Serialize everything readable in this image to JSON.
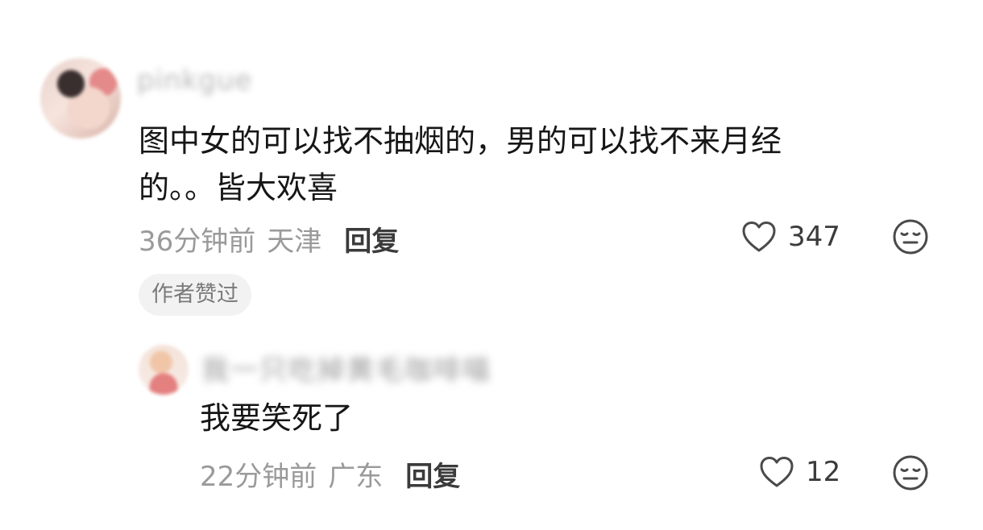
{
  "comment": {
    "username": "pinkgue",
    "text_line1": "图中女的可以找不抽烟的，男的可以找不来月经",
    "text_line2": "的。。皆大欢喜",
    "time": "36分钟前",
    "location": "天津",
    "reply_label": "回复",
    "like_count": "347",
    "badge": "作者赞过",
    "icons": {
      "like": "heart-outline-icon",
      "dislike": "neutral-face-icon"
    }
  },
  "reply": {
    "username": "我一只吃掉黄毛咖啡喵",
    "text": "我要笑死了",
    "time": "22分钟前",
    "location": "广东",
    "reply_label": "回复",
    "like_count": "12"
  }
}
